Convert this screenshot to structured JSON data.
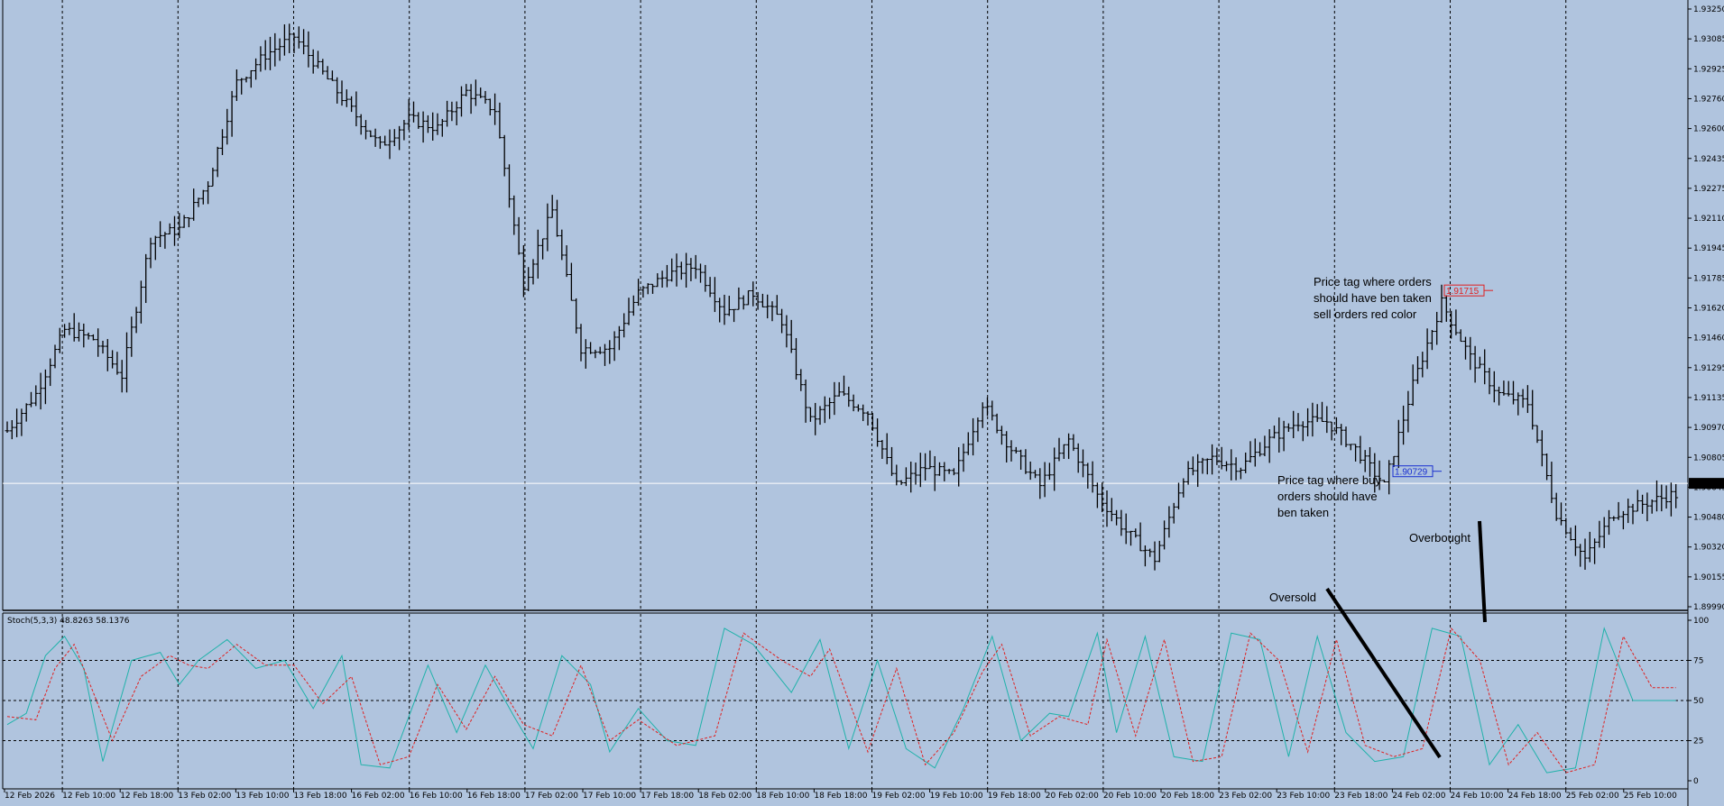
{
  "chart_data": [
    {
      "type": "ohlc",
      "price_axis": {
        "min": 1.8999,
        "max": 1.9325,
        "ticks": [
          "1.93250",
          "1.93085",
          "1.92925",
          "1.92760",
          "1.92600",
          "1.92435",
          "1.92275",
          "1.92110",
          "1.91945",
          "1.91785",
          "1.91620",
          "1.91460",
          "1.91295",
          "1.91135",
          "1.90970",
          "1.90805",
          "1.90645",
          "1.90480",
          "1.90320",
          "1.90155",
          "1.89990"
        ]
      },
      "current_price": "1.90663",
      "current_price_value": 1.90663,
      "time_labels": [
        "12 Feb 2026",
        "12 Feb 10:00",
        "12 Feb 18:00",
        "13 Feb 02:00",
        "13 Feb 10:00",
        "13 Feb 18:00",
        "16 Feb 02:00",
        "16 Feb 10:00",
        "16 Feb 18:00",
        "17 Feb 02:00",
        "17 Feb 10:00",
        "17 Feb 18:00",
        "18 Feb 02:00",
        "18 Feb 10:00",
        "18 Feb 18:00",
        "19 Feb 02:00",
        "19 Feb 10:00",
        "19 Feb 18:00",
        "20 Feb 02:00",
        "20 Feb 10:00",
        "20 Feb 18:00",
        "23 Feb 02:00",
        "23 Feb 10:00",
        "23 Feb 18:00",
        "24 Feb 02:00",
        "24 Feb 10:00",
        "24 Feb 18:00",
        "25 Feb 02:00",
        "25 Feb 10:00"
      ],
      "close_anchors": [
        [
          0,
          1.9095
        ],
        [
          6,
          1.9115
        ],
        [
          12,
          1.915
        ],
        [
          18,
          1.9145
        ],
        [
          24,
          1.9125
        ],
        [
          30,
          1.92
        ],
        [
          36,
          1.9205
        ],
        [
          42,
          1.923
        ],
        [
          48,
          1.9285
        ],
        [
          54,
          1.93
        ],
        [
          60,
          1.931
        ],
        [
          66,
          1.929
        ],
        [
          72,
          1.927
        ],
        [
          78,
          1.925
        ],
        [
          84,
          1.9265
        ],
        [
          90,
          1.926
        ],
        [
          96,
          1.928
        ],
        [
          102,
          1.927
        ],
        [
          108,
          1.9175
        ],
        [
          114,
          1.9215
        ],
        [
          120,
          1.914
        ],
        [
          126,
          1.914
        ],
        [
          132,
          1.917
        ],
        [
          138,
          1.918
        ],
        [
          144,
          1.9185
        ],
        [
          150,
          1.916
        ],
        [
          156,
          1.917
        ],
        [
          162,
          1.9155
        ],
        [
          168,
          1.91
        ],
        [
          174,
          1.9115
        ],
        [
          180,
          1.9105
        ],
        [
          186,
          1.9065
        ],
        [
          192,
          1.9075
        ],
        [
          198,
          1.907
        ],
        [
          204,
          1.911
        ],
        [
          210,
          1.9085
        ],
        [
          216,
          1.9065
        ],
        [
          222,
          1.909
        ],
        [
          228,
          1.906
        ],
        [
          234,
          1.904
        ],
        [
          240,
          1.9025
        ],
        [
          246,
          1.907
        ],
        [
          252,
          1.908
        ],
        [
          258,
          1.9075
        ],
        [
          264,
          1.909
        ],
        [
          270,
          1.91
        ],
        [
          276,
          1.91
        ],
        [
          282,
          1.9085
        ],
        [
          288,
          1.9065
        ],
        [
          294,
          1.912
        ],
        [
          300,
          1.9165
        ],
        [
          306,
          1.9135
        ],
        [
          312,
          1.9115
        ],
        [
          318,
          1.911
        ],
        [
          324,
          1.905
        ],
        [
          330,
          1.9025
        ],
        [
          336,
          1.905
        ],
        [
          342,
          1.9055
        ],
        [
          348,
          1.906
        ]
      ]
    },
    {
      "type": "line",
      "title": "Stoch(5,3,3) 48.8263 58.1376",
      "ylim": [
        0,
        100
      ],
      "levels": [
        25,
        50,
        75
      ],
      "ticks": [
        "100",
        "75",
        "50",
        "25",
        "0"
      ],
      "series": [
        {
          "color": "#20b2aa"
        },
        {
          "color": "#e02020"
        }
      ],
      "main_anchors": [
        [
          0,
          35
        ],
        [
          4,
          42
        ],
        [
          8,
          78
        ],
        [
          12,
          90
        ],
        [
          16,
          70
        ],
        [
          20,
          12
        ],
        [
          26,
          75
        ],
        [
          32,
          80
        ],
        [
          36,
          60
        ],
        [
          40,
          75
        ],
        [
          46,
          88
        ],
        [
          52,
          70
        ],
        [
          58,
          75
        ],
        [
          64,
          45
        ],
        [
          70,
          78
        ],
        [
          74,
          10
        ],
        [
          80,
          8
        ],
        [
          88,
          72
        ],
        [
          94,
          30
        ],
        [
          100,
          72
        ],
        [
          106,
          40
        ],
        [
          110,
          20
        ],
        [
          116,
          78
        ],
        [
          122,
          60
        ],
        [
          126,
          18
        ],
        [
          132,
          45
        ],
        [
          138,
          25
        ],
        [
          144,
          22
        ],
        [
          150,
          95
        ],
        [
          156,
          85
        ],
        [
          164,
          55
        ],
        [
          170,
          88
        ],
        [
          176,
          20
        ],
        [
          182,
          75
        ],
        [
          188,
          20
        ],
        [
          194,
          8
        ],
        [
          200,
          45
        ],
        [
          206,
          90
        ],
        [
          212,
          25
        ],
        [
          218,
          42
        ],
        [
          222,
          40
        ],
        [
          228,
          92
        ],
        [
          232,
          30
        ],
        [
          238,
          90
        ],
        [
          244,
          15
        ],
        [
          250,
          12
        ],
        [
          256,
          92
        ],
        [
          262,
          88
        ],
        [
          268,
          15
        ],
        [
          274,
          90
        ],
        [
          280,
          30
        ],
        [
          286,
          12
        ],
        [
          292,
          15
        ],
        [
          298,
          95
        ],
        [
          304,
          90
        ],
        [
          310,
          10
        ],
        [
          316,
          35
        ],
        [
          322,
          5
        ],
        [
          328,
          8
        ],
        [
          334,
          95
        ],
        [
          340,
          50
        ]
      ],
      "signal_anchors": [
        [
          0,
          40
        ],
        [
          6,
          38
        ],
        [
          10,
          70
        ],
        [
          14,
          85
        ],
        [
          18,
          55
        ],
        [
          22,
          25
        ],
        [
          28,
          65
        ],
        [
          34,
          78
        ],
        [
          38,
          72
        ],
        [
          42,
          70
        ],
        [
          48,
          85
        ],
        [
          54,
          72
        ],
        [
          60,
          72
        ],
        [
          66,
          48
        ],
        [
          72,
          65
        ],
        [
          78,
          10
        ],
        [
          84,
          15
        ],
        [
          90,
          60
        ],
        [
          96,
          32
        ],
        [
          102,
          65
        ],
        [
          108,
          35
        ],
        [
          114,
          28
        ],
        [
          120,
          72
        ],
        [
          126,
          25
        ],
        [
          132,
          38
        ],
        [
          140,
          22
        ],
        [
          148,
          28
        ],
        [
          154,
          92
        ],
        [
          162,
          75
        ],
        [
          168,
          65
        ],
        [
          172,
          82
        ],
        [
          180,
          18
        ],
        [
          186,
          70
        ],
        [
          192,
          10
        ],
        [
          198,
          30
        ],
        [
          204,
          68
        ],
        [
          208,
          85
        ],
        [
          214,
          28
        ],
        [
          220,
          40
        ],
        [
          226,
          35
        ],
        [
          230,
          88
        ],
        [
          236,
          28
        ],
        [
          242,
          88
        ],
        [
          248,
          12
        ],
        [
          254,
          15
        ],
        [
          260,
          92
        ],
        [
          266,
          75
        ],
        [
          272,
          18
        ],
        [
          278,
          88
        ],
        [
          284,
          22
        ],
        [
          290,
          15
        ],
        [
          296,
          20
        ],
        [
          302,
          95
        ],
        [
          308,
          75
        ],
        [
          314,
          10
        ],
        [
          320,
          30
        ],
        [
          326,
          5
        ],
        [
          332,
          10
        ],
        [
          338,
          90
        ],
        [
          344,
          58
        ]
      ]
    }
  ],
  "annotations": {
    "sell_note_lines": [
      "Price tag where orders",
      "should have ben taken",
      "sell orders red color"
    ],
    "buy_note_lines": [
      "Price tag where buy",
      "orders should have",
      "ben taken"
    ],
    "overbought": "Overbought",
    "oversold": "Oversold",
    "sell_tag": "1.91715",
    "sell_tag_value": 1.91715,
    "buy_tag": "1.90729",
    "buy_tag_value": 1.90729
  },
  "colors": {
    "background": "#b0c4de",
    "bars": "#000000",
    "grid": "#000000",
    "current_line": "#ffffff",
    "stoch_main": "#20b2aa",
    "stoch_signal": "#e02020",
    "sell": "#e02020",
    "buy": "#1a2fd0"
  }
}
